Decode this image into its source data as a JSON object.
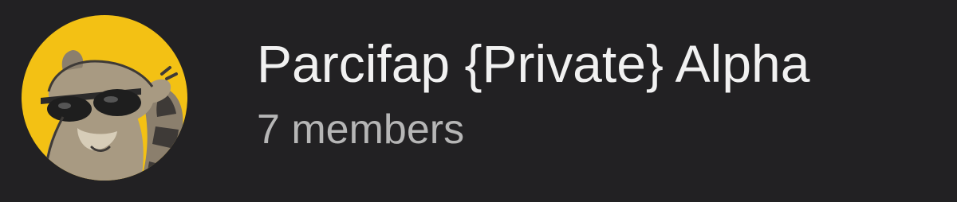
{
  "chat_header": {
    "avatar": {
      "icon": "raccoon-sunglasses-avatar-icon",
      "background_color": "#F3C114"
    },
    "title": "Parcifap {Private} Alpha",
    "subtitle": "7 members"
  },
  "colors": {
    "background": "#222123",
    "title_text": "#F1F1F1",
    "subtitle_text": "#B6B6B6"
  }
}
